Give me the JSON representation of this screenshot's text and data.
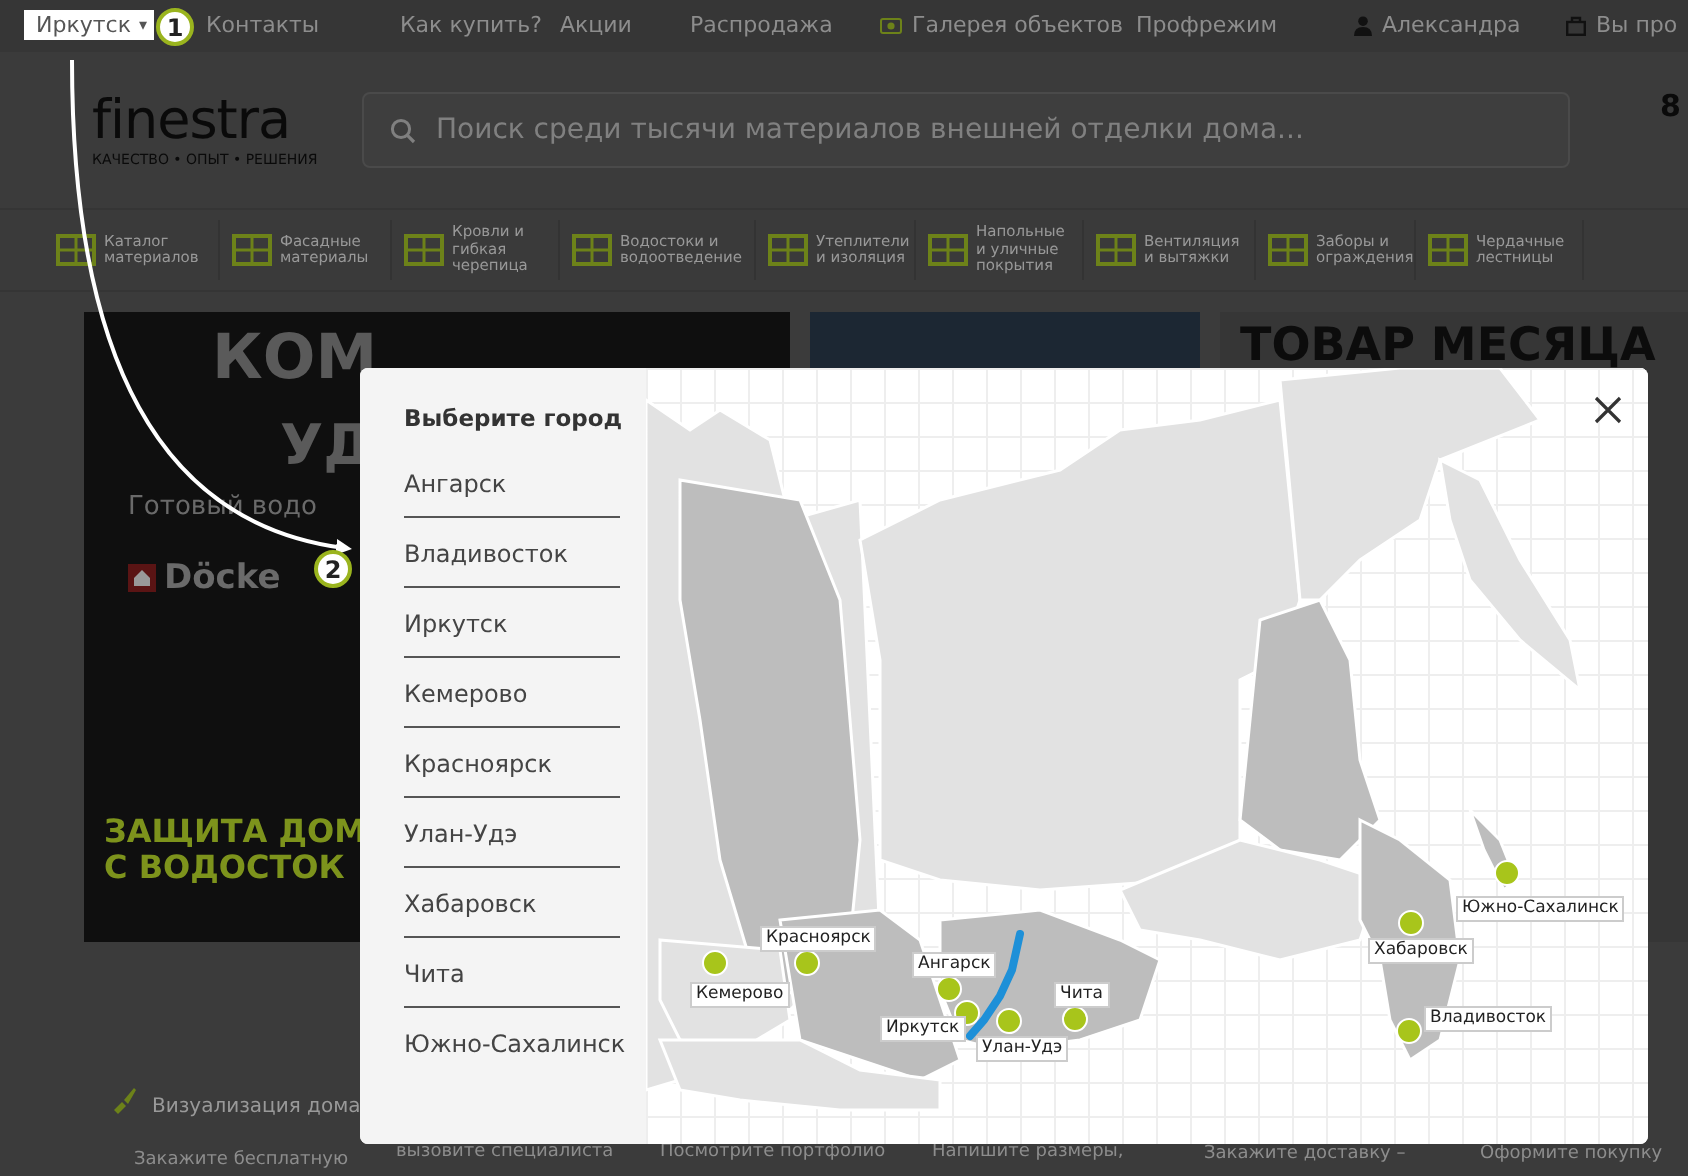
{
  "top_bar": {
    "city_selector": "Иркутск",
    "caret": "▾",
    "links": [
      {
        "label": "Контакты"
      },
      {
        "label": "Как купить?"
      },
      {
        "label": "Акции"
      },
      {
        "label": "Распродажа"
      },
      {
        "label": "Галерея объектов"
      },
      {
        "label": "Профрежим"
      },
      {
        "label": "Александра"
      },
      {
        "label": "Вы про"
      }
    ]
  },
  "header": {
    "logo": "finestra",
    "tagline": "КАЧЕСТВО • ОПЫТ • РЕШЕНИЯ",
    "search": {
      "placeholder": "Поиск среди тысячи материалов внешней отделки дома..."
    },
    "cart_count": "8"
  },
  "categories": [
    "Каталог материалов",
    "Фасадные материалы",
    "Кровли и гибкая черепица",
    "Водостоки и водоотведение",
    "Утеплители и изоляция",
    "Напольные и уличные покрытия",
    "Вентиляция и вытяжки",
    "Заборы и ограждения",
    "Чердачные лестницы"
  ],
  "banners": {
    "title_1": "КОМ",
    "title_2": "УД",
    "subtitle": "Готовый водо",
    "brand": "Döcke",
    "slogan_1": "ЗАЩИТА ДОМ",
    "slogan_2": "С ВОДОСТОК",
    "side_title": "ТОВАР МЕСЯЦА"
  },
  "services": [
    {
      "title": "Визуализация дома",
      "text": "Закажите бесплатную"
    },
    {
      "text": "вызовите специалиста"
    },
    {
      "text": "Посмотрите портфолио"
    },
    {
      "text": "Напишите размеры,"
    },
    {
      "text": "Закажите доставку –"
    },
    {
      "text": "Оформите покупку"
    }
  ],
  "city_dialog": {
    "heading": "Выберите город",
    "cities": [
      "Ангарск",
      "Владивосток",
      "Иркутск",
      "Кемерово",
      "Красноярск",
      "Улан-Удэ",
      "Хабаровск",
      "Чита",
      "Южно-Сахалинск"
    ],
    "map_markers": [
      "Южно-Сахалинск",
      "Хабаровск",
      "Красноярск",
      "Ангарск",
      "Кемерово",
      "Чита",
      "Владивосток",
      "Иркутск",
      "Улан-Удэ"
    ]
  },
  "annotations": [
    "1",
    "2"
  ]
}
